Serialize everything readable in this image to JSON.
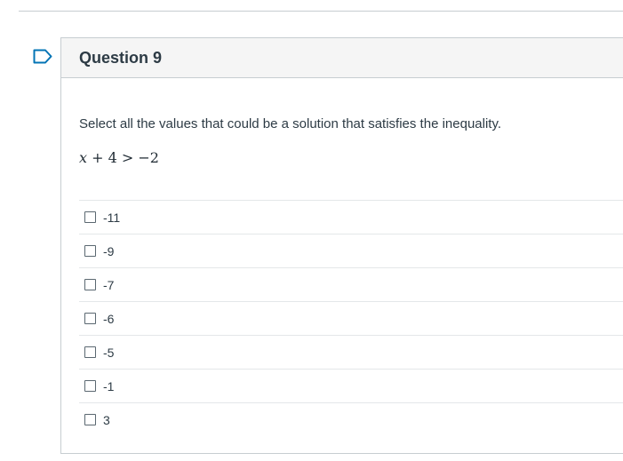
{
  "question": {
    "title": "Question 9",
    "text": "Select all the values that could be a solution that satisfies the inequality.",
    "equation": {
      "variable": "x",
      "rest": " + 4 > −2"
    },
    "answers": [
      {
        "label": "-11",
        "checked": false
      },
      {
        "label": "-9",
        "checked": false
      },
      {
        "label": "-7",
        "checked": false
      },
      {
        "label": "-6",
        "checked": false
      },
      {
        "label": "-5",
        "checked": false
      },
      {
        "label": "-1",
        "checked": false
      },
      {
        "label": "3",
        "checked": false
      }
    ]
  },
  "icons": {
    "flag": "flag-question-icon"
  },
  "colors": {
    "header_bg": "#f5f5f5",
    "border": "#c7cdd1",
    "text": "#2d3b45",
    "flag": "#0374b5"
  }
}
